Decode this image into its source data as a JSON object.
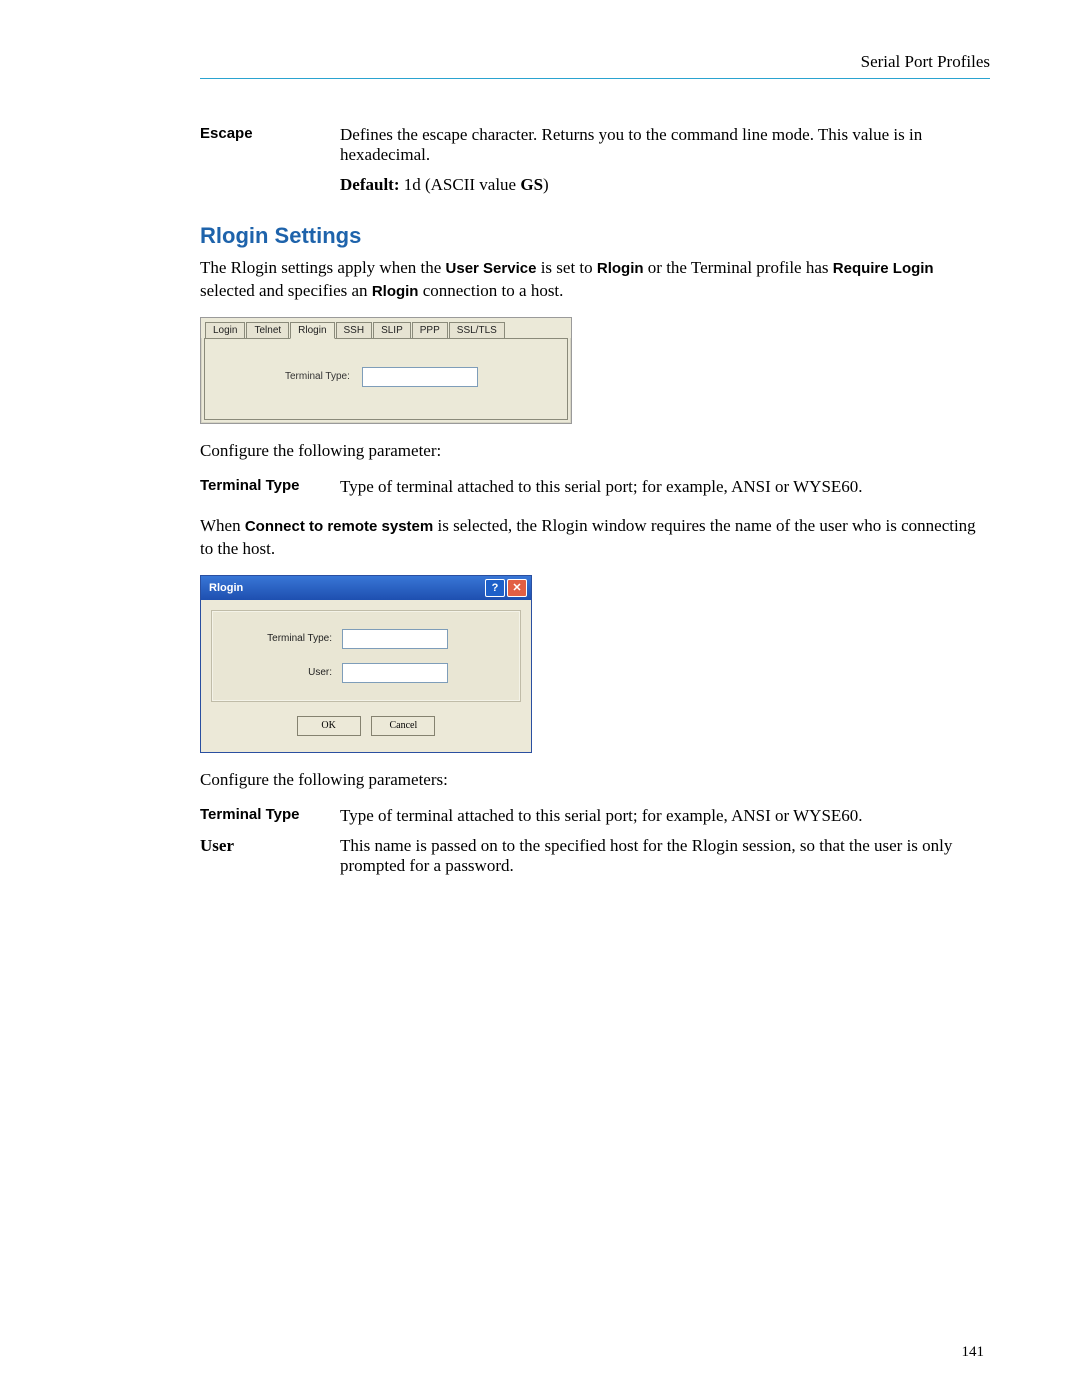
{
  "header": "Serial Port Profiles",
  "escape": {
    "term": "Escape",
    "body": "Defines the escape character. Returns you to the command line mode. This value is in hexadecimal.",
    "default_label": "Default:",
    "default_value_pre": " 1d (ASCII value ",
    "default_value_bold": "GS",
    "default_value_post": ")"
  },
  "section_title": "Rlogin Settings",
  "intro": {
    "pre": "The Rlogin settings apply when the ",
    "b1": "User Service",
    "mid1": " is set to ",
    "b2": "Rlogin",
    "mid2": " or the Terminal profile has ",
    "b3": "Require Login",
    "post": " selected and specifies an ",
    "b4": "Rlogin",
    "tail": " connection to a host."
  },
  "fig1": {
    "tabs": [
      "Login",
      "Telnet",
      "Rlogin",
      "SSH",
      "SLIP",
      "PPP",
      "SSL/TLS"
    ],
    "active_tab": 2,
    "field_label": "Terminal Type:"
  },
  "configure1": "Configure the following parameter:",
  "row_tt1": {
    "term": "Terminal Type",
    "body": "Type of terminal attached to this serial port; for example, ANSI or WYSE60."
  },
  "connect_para": {
    "pre": "When ",
    "b": "Connect to remote system",
    "post": " is selected, the Rlogin window requires the name of the user who is connecting to the host."
  },
  "fig2": {
    "title": "Rlogin",
    "help": "?",
    "close": "✕",
    "field1": "Terminal Type:",
    "field2": "User:",
    "ok": "OK",
    "cancel": "Cancel"
  },
  "configure2": "Configure the following parameters:",
  "row_tt2": {
    "term": "Terminal Type",
    "body": "Type of terminal attached to this serial port; for example, ANSI or WYSE60."
  },
  "row_user": {
    "term": "User",
    "body": "This name is passed on to the specified host for the Rlogin session, so that the user is only prompted for a password."
  },
  "page_number": "141"
}
